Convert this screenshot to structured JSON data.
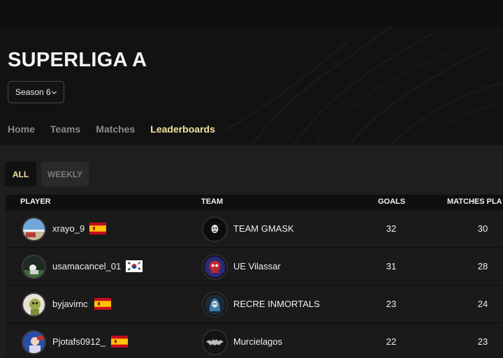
{
  "league": {
    "title": "SUPERLIGA A",
    "season": "Season 6"
  },
  "nav": [
    {
      "label": "Home",
      "active": false
    },
    {
      "label": "Teams",
      "active": false
    },
    {
      "label": "Matches",
      "active": false
    },
    {
      "label": "Leaderboards",
      "active": true
    }
  ],
  "filters": {
    "all": "ALL",
    "weekly": "WEEKLY",
    "selected": "ALL"
  },
  "table": {
    "headers": {
      "player": "PLAYER",
      "team": "TEAM",
      "goals": "GOALS",
      "matches": "MATCHES PLA"
    },
    "rows": [
      {
        "player": "xrayo_9",
        "flag": "spain-flag-icon",
        "team": "TEAM GMASK",
        "goals": "32",
        "matches": "30"
      },
      {
        "player": "usamacancel_01",
        "flag": "south-korea-flag-icon",
        "team": "UE Vilassar",
        "goals": "31",
        "matches": "28"
      },
      {
        "player": "byjavimc",
        "flag": "spain-flag-icon",
        "team": "RECRE INMORTALS",
        "goals": "23",
        "matches": "24"
      },
      {
        "player": "Pjotafs0912_",
        "flag": "spain-flag-icon",
        "team": "Murcielagos",
        "goals": "22",
        "matches": "23"
      }
    ]
  },
  "colors": {
    "accent": "#f3e4a0",
    "background": "#1c1c1c",
    "header": "#121212"
  }
}
